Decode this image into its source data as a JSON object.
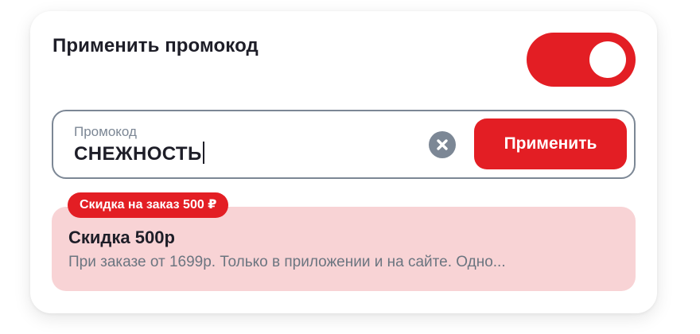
{
  "promo": {
    "title": "Применить промокод",
    "toggle_on": true,
    "input": {
      "label": "Промокод",
      "value": "СНЕЖНОСТЬ"
    },
    "clear_icon": "close-circle-icon",
    "apply_label": "Применить",
    "offer": {
      "badge": "Скидка на заказ 500 ₽",
      "title": "Скидка 500р",
      "description": "При заказе от 1699р. Только в приложении и на сайте. Одно..."
    }
  },
  "colors": {
    "accent": "#e31e24",
    "offer_bg": "#f8d3d5",
    "muted": "#7c8795",
    "text": "#1e1e28"
  }
}
